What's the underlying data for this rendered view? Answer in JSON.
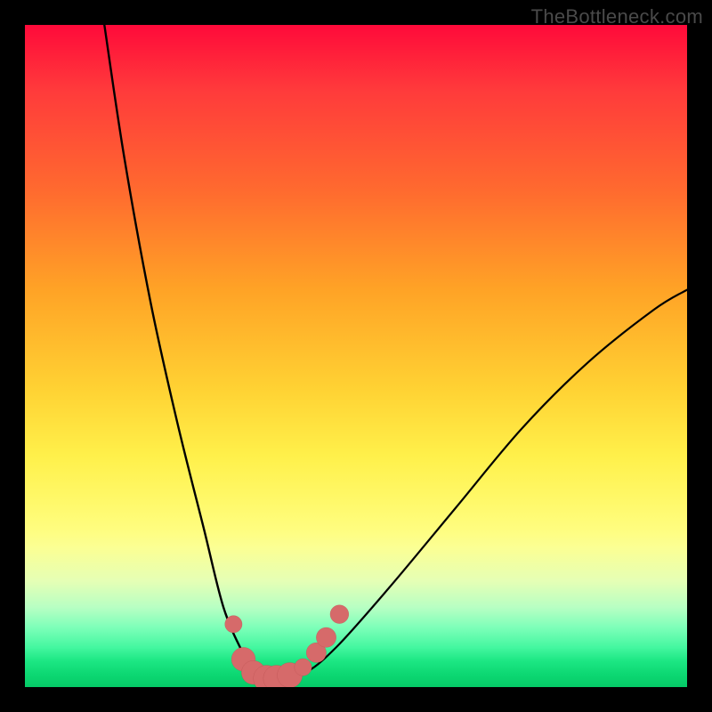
{
  "watermark": "TheBottleneck.com",
  "colors": {
    "curve": "#000000",
    "dot_fill": "#d66a6a",
    "dot_stroke": "#b84f4f"
  },
  "chart_data": {
    "type": "line",
    "title": "",
    "xlabel": "",
    "ylabel": "",
    "xlim": [
      0,
      100
    ],
    "ylim": [
      0,
      100
    ],
    "series": [
      {
        "name": "left-curve",
        "points": [
          {
            "x": 12,
            "y": 100
          },
          {
            "x": 15,
            "y": 80
          },
          {
            "x": 19,
            "y": 58
          },
          {
            "x": 23,
            "y": 40
          },
          {
            "x": 27,
            "y": 24
          },
          {
            "x": 30,
            "y": 12
          },
          {
            "x": 33,
            "y": 5
          },
          {
            "x": 35,
            "y": 2
          },
          {
            "x": 37,
            "y": 1
          }
        ]
      },
      {
        "name": "right-curve",
        "points": [
          {
            "x": 37,
            "y": 1
          },
          {
            "x": 42,
            "y": 2
          },
          {
            "x": 47,
            "y": 6
          },
          {
            "x": 55,
            "y": 15
          },
          {
            "x": 65,
            "y": 27
          },
          {
            "x": 75,
            "y": 39
          },
          {
            "x": 85,
            "y": 49
          },
          {
            "x": 95,
            "y": 57
          },
          {
            "x": 100,
            "y": 60
          }
        ]
      }
    ],
    "markers": [
      {
        "x": 31.5,
        "y": 9.5,
        "r": 1.3
      },
      {
        "x": 33.0,
        "y": 4.2,
        "r": 1.8
      },
      {
        "x": 34.5,
        "y": 2.2,
        "r": 1.8
      },
      {
        "x": 36.5,
        "y": 1.3,
        "r": 2.0
      },
      {
        "x": 38.0,
        "y": 1.3,
        "r": 2.0
      },
      {
        "x": 40.0,
        "y": 1.8,
        "r": 1.9
      },
      {
        "x": 42.0,
        "y": 3.0,
        "r": 1.3
      },
      {
        "x": 44.0,
        "y": 5.2,
        "r": 1.5
      },
      {
        "x": 45.5,
        "y": 7.5,
        "r": 1.5
      },
      {
        "x": 47.5,
        "y": 11.0,
        "r": 1.4
      }
    ]
  }
}
